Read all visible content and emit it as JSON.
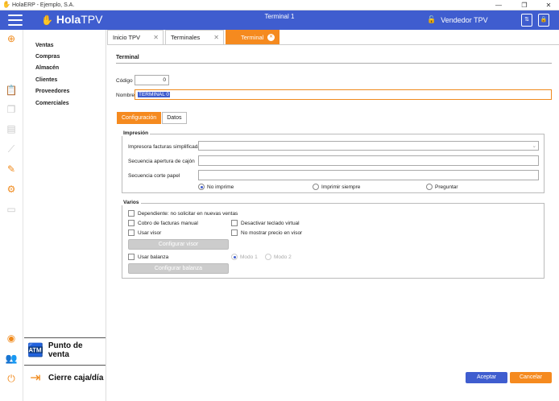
{
  "window": {
    "title": "HolaERP - Ejemplo, S.A.",
    "min": "—",
    "restore": "❐",
    "close": "✕"
  },
  "header": {
    "logo_hola": "Hola",
    "logo_tpv": "TPV",
    "title": "Terminal 1",
    "seller": "Vendedor TPV"
  },
  "menu": {
    "items": [
      "Ventas",
      "Compras",
      "Almacén",
      "Clientes",
      "Proveedores",
      "Comerciales"
    ],
    "punto_venta": "Punto de venta",
    "cierre_caja": "Cierre caja/día"
  },
  "tabs": [
    {
      "label": "Inicio TPV"
    },
    {
      "label": "Terminales"
    },
    {
      "label": "Terminal"
    }
  ],
  "form": {
    "section_title": "Terminal",
    "codigo_label": "Código",
    "codigo_value": "0",
    "nombre_label": "Nombre",
    "nombre_value": "TERMINAL 0"
  },
  "subtabs": [
    "Configuración",
    "Datos"
  ],
  "impresion": {
    "legend": "Impresión",
    "impresora_label": "Impresora facturas simplificadas",
    "secuencia_apertura_label": "Secuencia apertura de cajón",
    "secuencia_corte_label": "Secuencia corte papel",
    "radio_no_imprime": "No imprime",
    "radio_imprimir_siempre": "Imprimir siempre",
    "radio_preguntar": "Preguntar"
  },
  "varios": {
    "legend": "Varios",
    "dependiente": "Dependiente: no solicitar en nuevas ventas",
    "cobro_manual": "Cobro de facturas manual",
    "desactivar_teclado": "Desactivar teclado virtual",
    "usar_visor": "Usar visor",
    "no_mostrar_precio": "No mostrar precio en visor",
    "configurar_visor": "Configurar visor",
    "usar_balanza": "Usar balanza",
    "modo1": "Modo 1",
    "modo2": "Modo 2",
    "configurar_balanza": "Configurar balanza"
  },
  "footer": {
    "aceptar": "Aceptar",
    "cancelar": "Cancelar"
  },
  "colors": {
    "brand_blue": "#3f5dcf",
    "accent_orange": "#f58a1f"
  }
}
